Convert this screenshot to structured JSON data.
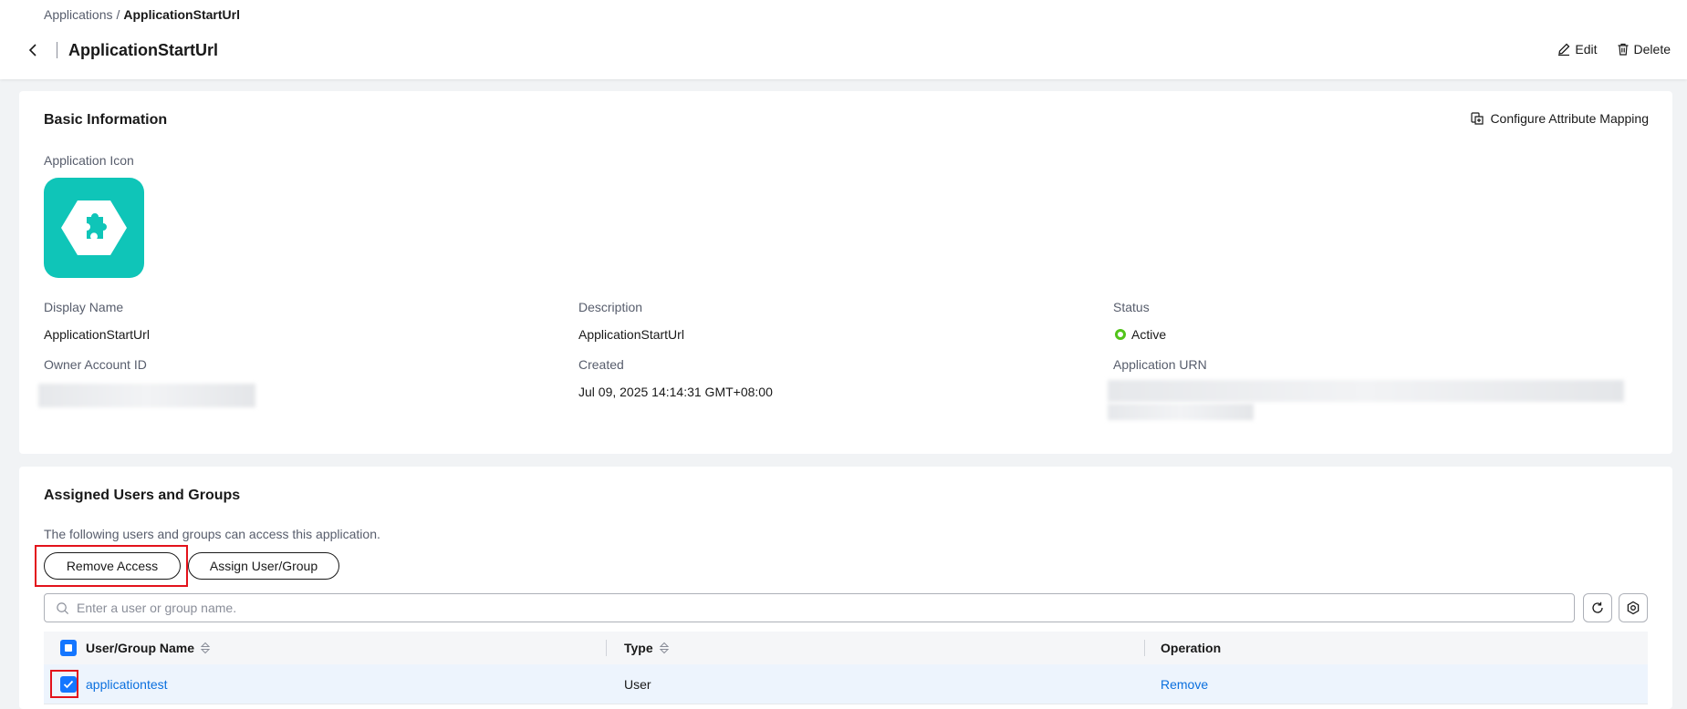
{
  "header": {
    "breadcrumb_root": "Applications",
    "breadcrumb_sep": "/",
    "breadcrumb_current": "ApplicationStartUrl",
    "title": "ApplicationStartUrl",
    "edit_label": "Edit",
    "delete_label": "Delete"
  },
  "basic": {
    "title": "Basic Information",
    "configure_label": "Configure Attribute Mapping",
    "icon_label": "Application Icon",
    "display_name_label": "Display Name",
    "display_name": "ApplicationStartUrl",
    "description_label": "Description",
    "description": "ApplicationStartUrl",
    "status_label": "Status",
    "status": "Active",
    "owner_label": "Owner Account ID",
    "created_label": "Created",
    "created": "Jul 09, 2025 14:14:31 GMT+08:00",
    "urn_label": "Application URN"
  },
  "assigned": {
    "title": "Assigned Users and Groups",
    "subtitle": "The following users and groups can access this application.",
    "remove_access_label": "Remove Access",
    "assign_label": "Assign User/Group",
    "search_placeholder": "Enter a user or group name.",
    "columns": [
      "User/Group Name",
      "Type",
      "Operation"
    ],
    "rows": [
      {
        "name": "applicationtest",
        "type": "User",
        "operation": "Remove"
      }
    ]
  },
  "colors": {
    "accent": "#1476ff",
    "app_icon": "#0fc5b8",
    "status_active": "#52c41a",
    "highlight_box": "#e3121b"
  }
}
